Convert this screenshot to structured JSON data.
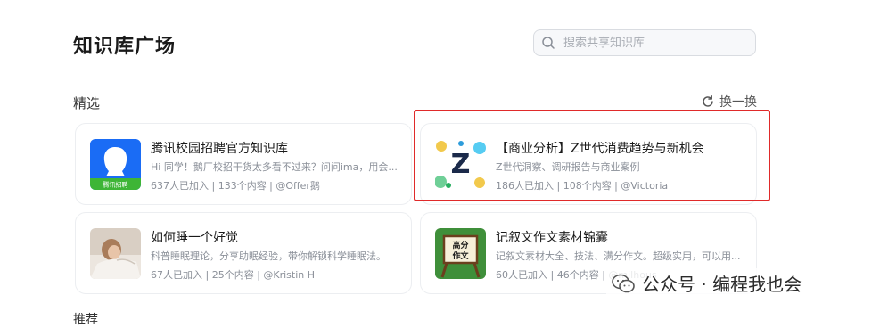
{
  "page": {
    "title": "知识库广场"
  },
  "search": {
    "placeholder": "搜索共享知识库"
  },
  "section": {
    "label": "精选",
    "refresh_label": "换一换"
  },
  "cards": [
    {
      "title": "腾讯校园招聘官方知识库",
      "desc": "Hi 同学！鹅厂校招干货太多看不过来？问问ima，用会...",
      "meta": "637人已加入 | 133个内容 | @Offer鹅",
      "thumb_text": "腾讯招聘"
    },
    {
      "title": "【商业分析】Z世代消费趋势与新机会",
      "desc": "Z世代洞察、调研报告与商业案例",
      "meta": "186人已加入 | 108个内容 | @Victoria",
      "thumb_text": "Z"
    },
    {
      "title": "如何睡一个好觉",
      "desc": "科普睡眠理论，分享助眠经验，带你解锁科学睡眠法。",
      "meta": "67人已加入 | 25个内容 | @Kristin H",
      "thumb_text": ""
    },
    {
      "title": "记叙文作文素材锦囊",
      "desc": "记叙文素材大全、技法、满分作文。超级实用，可以用...",
      "meta": "60人已加入 | 46个内容 | @milhous",
      "thumb_text": "高分作文"
    }
  ],
  "watermark": {
    "text": "公众号 · 编程我也会"
  },
  "bottom": {
    "label": "推荐"
  },
  "colors": {
    "highlight": "#e02a2a",
    "tencent_blue": "#1a6cf5",
    "tencent_green": "#3eb536"
  }
}
